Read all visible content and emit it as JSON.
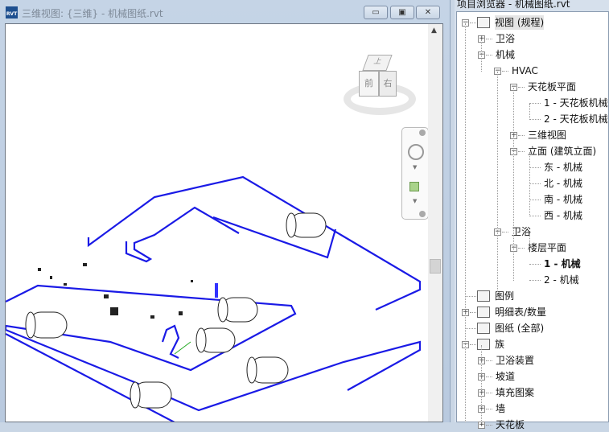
{
  "window": {
    "icon_label": "RVT",
    "title": "三维视图: {三维} - 机械图纸.rvt",
    "minimize": "▭",
    "restore": "▣",
    "close": "✕"
  },
  "viewcube": {
    "top": "上",
    "front": "前",
    "right": "右"
  },
  "scroll_up": "▲",
  "browser": {
    "title": "项目浏览器 - 机械图纸.rvt",
    "items": [
      {
        "label": "视图 (规程)",
        "exp": "−"
      },
      {
        "label": "卫浴",
        "exp": "+"
      },
      {
        "label": "机械",
        "exp": "−"
      },
      {
        "label": "HVAC",
        "exp": "−"
      },
      {
        "label": "天花板平面",
        "exp": "−"
      },
      {
        "label": "1 - 天花板机械"
      },
      {
        "label": "2 - 天花板机械"
      },
      {
        "label": "三维视图",
        "exp": "+"
      },
      {
        "label": "立面 (建筑立面)",
        "exp": "−"
      },
      {
        "label": "东 - 机械"
      },
      {
        "label": "北 - 机械"
      },
      {
        "label": "南 - 机械"
      },
      {
        "label": "西 - 机械"
      },
      {
        "label": "卫浴",
        "exp": "−"
      },
      {
        "label": "楼层平面",
        "exp": "−"
      },
      {
        "label": "1 - 机械"
      },
      {
        "label": "2 - 机械"
      },
      {
        "label": "图例"
      },
      {
        "label": "明细表/数量",
        "exp": "+"
      },
      {
        "label": "图纸 (全部)"
      },
      {
        "label": "族",
        "exp": "−"
      },
      {
        "label": "卫浴装置",
        "exp": "+"
      },
      {
        "label": "坡道",
        "exp": "+"
      },
      {
        "label": "填充图案",
        "exp": "+"
      },
      {
        "label": "墙",
        "exp": "+"
      },
      {
        "label": "天花板",
        "exp": "+"
      }
    ]
  }
}
